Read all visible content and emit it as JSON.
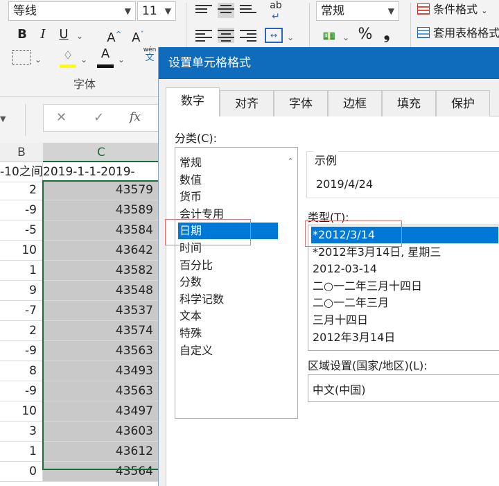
{
  "ribbon": {
    "font_name": "等线",
    "font_size": "11",
    "bold": "B",
    "italic": "I",
    "underline": "U",
    "grow_font": "A",
    "shrink_font": "A",
    "font_color_letter": "A",
    "wen_label": "wén",
    "wen_char": "文",
    "font_group_label": "字体",
    "number_format": "常规",
    "percent": "%",
    "comma": "❟",
    "wrap_icon": "ab",
    "conditional_format": "条件格式",
    "table_format": "套用表格格式"
  },
  "formula_bar": {
    "cancel": "✕",
    "enter": "✓",
    "fx": "fx"
  },
  "sheet": {
    "columns": [
      "B",
      "C"
    ],
    "header_row": {
      "b": "-10之间",
      "c": "2019-1-1-2019-"
    },
    "rows": [
      {
        "b": "2",
        "c": "43579"
      },
      {
        "b": "-9",
        "c": "43589"
      },
      {
        "b": "-5",
        "c": "43584"
      },
      {
        "b": "10",
        "c": "43642"
      },
      {
        "b": "1",
        "c": "43582"
      },
      {
        "b": "9",
        "c": "43548"
      },
      {
        "b": "-7",
        "c": "43537"
      },
      {
        "b": "2",
        "c": "43574"
      },
      {
        "b": "-9",
        "c": "43563"
      },
      {
        "b": "8",
        "c": "43493"
      },
      {
        "b": "-9",
        "c": "43563"
      },
      {
        "b": "10",
        "c": "43497"
      },
      {
        "b": "3",
        "c": "43603"
      },
      {
        "b": "1",
        "c": "43612"
      },
      {
        "b": "0",
        "c": "43564"
      }
    ]
  },
  "dialog": {
    "title": "设置单元格格式",
    "tabs": [
      "数字",
      "对齐",
      "字体",
      "边框",
      "填充",
      "保护"
    ],
    "category_label": "分类(C):",
    "categories": [
      "常规",
      "数值",
      "货币",
      "会计专用",
      "日期",
      "时间",
      "百分比",
      "分数",
      "科学记数",
      "文本",
      "特殊",
      "自定义"
    ],
    "selected_category": "日期",
    "sample_label": "示例",
    "sample_value": "2019/4/24",
    "type_label": "类型(T):",
    "types": [
      "*2012/3/14",
      "*2012年3月14日, 星期三",
      "2012-03-14",
      "二○一二年三月十四日",
      "二○一二年三月",
      "三月十四日",
      "2012年3月14日"
    ],
    "selected_type": "*2012/3/14",
    "locale_label": "区域设置(国家/地区)(L):",
    "locale_value": "中文(中国)"
  }
}
